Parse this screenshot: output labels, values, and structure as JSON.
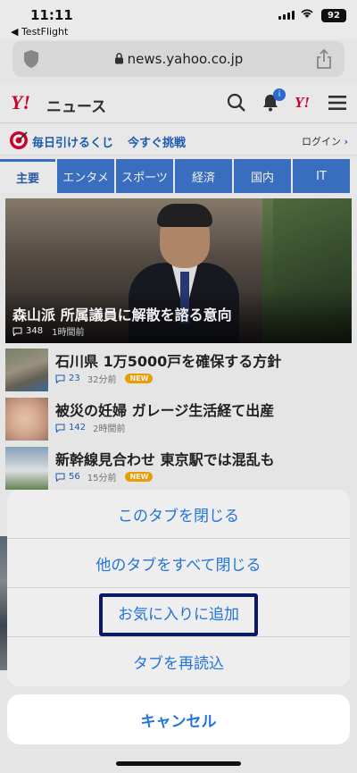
{
  "status": {
    "time": "11:11",
    "back_label": "◀ TestFlight",
    "battery": "92"
  },
  "browser": {
    "url": "news.yahoo.co.jp",
    "lock_glyph": "🔒"
  },
  "header": {
    "logo": "Y!",
    "logo_sub": "ニュース",
    "badge_count": "i",
    "yjapan": "Y!"
  },
  "promo": {
    "lottery": "毎日引けるくじ",
    "challenge": "今すぐ挑戦",
    "login": "ログイン"
  },
  "tabs": [
    "主要",
    "エンタメ",
    "スポーツ",
    "経済",
    "国内",
    "IT"
  ],
  "hero": {
    "title": "森山派 所属議員に解散を諮る意向",
    "comments": "348",
    "time": "1時間前"
  },
  "news": [
    {
      "title": "石川県 1万5000戸を確保する方針",
      "comments": "23",
      "time": "32分前",
      "is_new": true,
      "new_label": "NEW"
    },
    {
      "title": "被災の妊婦 ガレージ生活経て出産",
      "comments": "142",
      "time": "2時間前",
      "is_new": false,
      "new_label": ""
    },
    {
      "title": "新幹線見合わせ 東京駅では混乱も",
      "comments": "56",
      "time": "15分前",
      "is_new": true,
      "new_label": "NEW"
    }
  ],
  "sheet": {
    "items": [
      "このタブを閉じる",
      "他のタブをすべて閉じる",
      "お気に入りに追加",
      "タブを再読込"
    ],
    "cancel": "キャンセル"
  }
}
